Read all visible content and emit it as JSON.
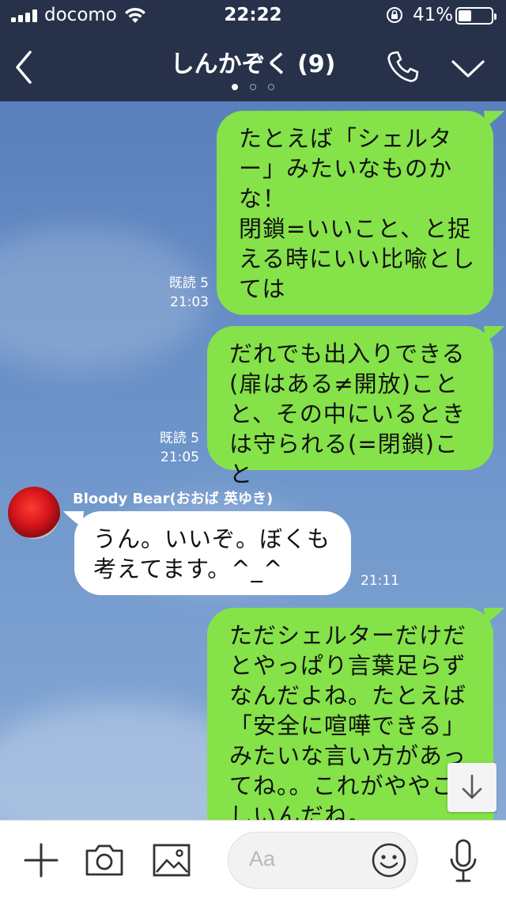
{
  "status_bar": {
    "carrier": "docomo",
    "time": "22:22",
    "battery_percent": "41%",
    "battery_level": 0.41
  },
  "header": {
    "title": "しんかぞく (9)",
    "page_dots": 3,
    "active_dot": 0,
    "back_icon": "chevron-left-icon",
    "call_icon": "phone-icon",
    "menu_icon": "chevron-down-icon"
  },
  "messages": [
    {
      "side": "sent",
      "text": "たとえば「シェルタ\nー」みたいなものか\nな！\n閉鎖=いいこと、と捉\nえる時にいい比喩とし\nては",
      "read": "既読 5",
      "time": "21:03"
    },
    {
      "side": "sent",
      "text": "だれでも出入りできる\n(扉はある≠開放)こと\nと、その中にいるとき\nは守られる(=閉鎖)こと",
      "read": "既読 5",
      "time": "21:05"
    },
    {
      "side": "received",
      "sender": "Bloody Bear(おおば 英ゆき)",
      "text": "うん。いいぞ。ぼくも\n考えてます。^_^",
      "time": "21:11"
    },
    {
      "side": "sent",
      "text": "ただシェルターだけだ\nとやっぱり言葉足らず\nなんだよね。たとえば\n「安全に喧嘩できる」\nみたいな言い方があっ\nてね。。これがややこ\nしいんだね。"
    }
  ],
  "input": {
    "placeholder": "Aa"
  },
  "colors": {
    "header_bg": "#27324a",
    "sent_bubble": "#85e249",
    "received_bubble": "#ffffff",
    "chat_bg": "#6f95c9"
  }
}
